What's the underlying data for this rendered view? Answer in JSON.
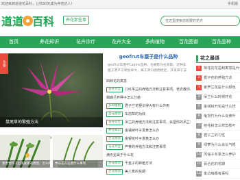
{
  "topbar": {
    "welcome": "欢迎来到道道花百科，让你30天成为养花达人！",
    "mobile": "手机版"
  },
  "header": {
    "logo_text_1": "道道",
    "logo_text_2": "百科",
    "slogan": "养花那些事",
    "search_placeholder": "在这里搜索您想要的花卉"
  },
  "nav": [
    "首页",
    "养花知识",
    "花卉诊疗",
    "花卉大全",
    "多肉植物",
    "百花图谱",
    "百花品种"
  ],
  "banner": {
    "corner_label": "头条",
    "caption": "鼠尾草的繁殖方法",
    "dots": 5,
    "active_dot": 0
  },
  "thumbs": [
    {
      "caption": "富贵竹叶子出现发黄的原因，怎么养护？"
    },
    {
      "caption": "水培花卉注意什么事项"
    }
  ],
  "main": {
    "headline": "geofrut车厘子是什么品种",
    "summary": "geofrut车厘子Lapins品种，也被称为拉宾斯。这种车厘子原产于新加拿大，属于高口感而稳定，开发早于该",
    "rows": [
      {
        "tag": "",
        "title": "四种花的寓意"
      },
      {
        "tag": "花卉大全",
        "title": "口红吊兰的养殖方法和注意事项，老农教你八"
      },
      {
        "tag": "",
        "title": "蝴蝶兰养种子怎么分苗"
      },
      {
        "tag": "多肉植物",
        "title": "君子兰花梗长得大有什么作用"
      },
      {
        "tag": "百花图谱",
        "title": "车前草的功效"
      },
      {
        "tag": "花卉诊疗",
        "title": "吊兰的养殖方法和注意事项，会把你的吊兰花"
      },
      {
        "tag": "养花知识",
        "title": "金钱树叶子发黄怎么办"
      },
      {
        "tag": "百花图谱",
        "title": "金银花叶子发黄怎么办"
      },
      {
        "tag": "花卉大全",
        "title": "芦荟的养殖方法和注意事项"
      },
      {
        "tag": "",
        "title": "满天星属于什么花"
      },
      {
        "tag": "百花图谱",
        "title": "千金子的种植方法"
      },
      {
        "tag": "百花图谱",
        "title": "美人蕉的花期"
      }
    ]
  },
  "sidebar": {
    "title": "花之最语",
    "items": [
      {
        "num": "1",
        "text": "荷花的花语和寓意是什么"
      },
      {
        "num": "2",
        "text": "栀子花的养殖方法"
      },
      {
        "num": "3",
        "text": "紫罗兰花是什么颜色"
      },
      {
        "num": "4",
        "text": "吊兰什么时候开花"
      },
      {
        "num": "5",
        "text": "金钱树开花是什么样"
      },
      {
        "num": "6",
        "text": "龟背竹为什么会黄叶"
      },
      {
        "num": "7",
        "text": "桂花树怎么修剪枝叶"
      },
      {
        "num": "8",
        "text": "君子兰的习性"
      },
      {
        "num": "9",
        "text": "绿萝为什么会长气根"
      },
      {
        "num": "10",
        "text": "风信子冬季怎么养护"
      },
      {
        "num": "11",
        "text": "百合花的花期"
      },
      {
        "num": "12",
        "text": "金边瑞香有毒吗"
      }
    ]
  },
  "colors": {
    "brand": "#2aa457",
    "link": "#2a66b0",
    "hot": "#e94b3c"
  }
}
